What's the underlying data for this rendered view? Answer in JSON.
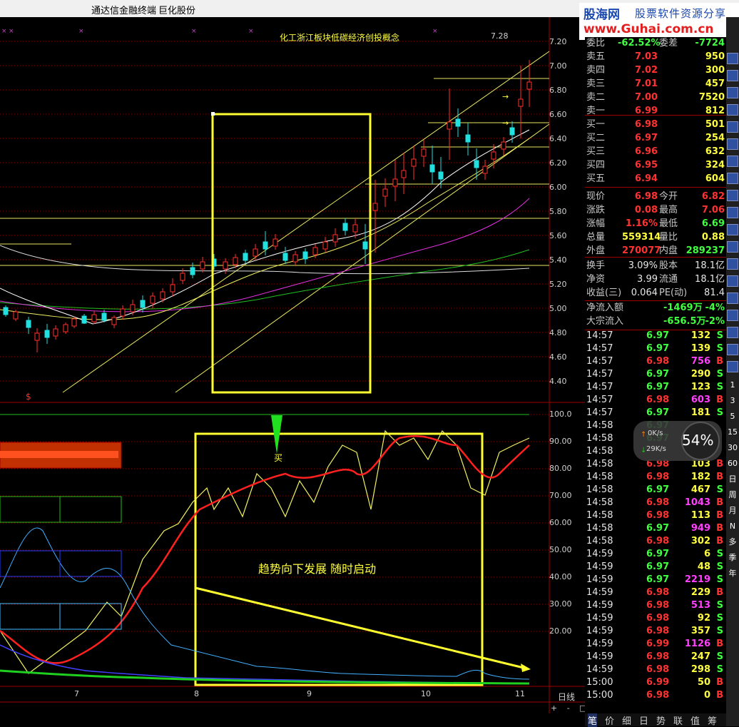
{
  "titlebar": {
    "app": "通达信金融终端",
    "stock": "巨化股份"
  },
  "watermark": {
    "brand": "股海网",
    "slogan": "股票软件资源分享",
    "url": "www.Guhai.com.cn"
  },
  "chart": {
    "title": "化工浙江板块低碳经济创投概念",
    "high_marker": "7.28",
    "annotation": "趋势向下发展 随时启动",
    "signal_label": "买",
    "period_label": "日线",
    "s_mark": "$",
    "price_axis": [
      "7.20",
      "7.00",
      "6.80",
      "6.60",
      "6.40",
      "6.20",
      "6.00",
      "5.80",
      "5.60",
      "5.40",
      "5.20",
      "5.00",
      "4.80",
      "4.60",
      "4.40"
    ],
    "osc_axis": [
      "100.0",
      "90.00",
      "80.00",
      "70.00",
      "60.00",
      "50.00",
      "40.00",
      "30.00",
      "20.00"
    ],
    "x_labels": [
      "7",
      "8",
      "9",
      "10",
      "11"
    ],
    "zoom": [
      "+",
      "-",
      "□"
    ]
  },
  "quote": {
    "weibi": {
      "label": "委比",
      "value": "-62.52%",
      "label2": "委差",
      "value2": "-7724"
    },
    "asks": [
      {
        "label": "卖五",
        "price": "7.03",
        "vol": "950"
      },
      {
        "label": "卖四",
        "price": "7.02",
        "vol": "300"
      },
      {
        "label": "卖三",
        "price": "7.01",
        "vol": "457"
      },
      {
        "label": "卖二",
        "price": "7.00",
        "vol": "7520"
      },
      {
        "label": "卖一",
        "price": "6.99",
        "vol": "812"
      }
    ],
    "bids": [
      {
        "label": "买一",
        "price": "6.98",
        "vol": "501"
      },
      {
        "label": "买二",
        "price": "6.97",
        "vol": "254"
      },
      {
        "label": "买三",
        "price": "6.96",
        "vol": "632"
      },
      {
        "label": "买四",
        "price": "6.95",
        "vol": "324"
      },
      {
        "label": "买五",
        "price": "6.94",
        "vol": "604"
      }
    ],
    "stats": [
      {
        "l1": "现价",
        "v1": "6.98",
        "l2": "今开",
        "v2": "6.82"
      },
      {
        "l1": "涨跌",
        "v1": "0.08",
        "l2": "最高",
        "v2": "7.06"
      },
      {
        "l1": "涨幅",
        "v1": "1.16%",
        "l2": "最低",
        "v2": "6.69"
      },
      {
        "l1": "总量",
        "v1": "559314",
        "l2": "量比",
        "v2": "0.88"
      },
      {
        "l1": "外盘",
        "v1": "270077",
        "l2": "内盘",
        "v2": "289237"
      }
    ],
    "fund": [
      {
        "l1": "换手",
        "v1": "3.09%",
        "l2": "股本",
        "v2": "18.1亿"
      },
      {
        "l1": "净资",
        "v1": "3.99",
        "l2": "流通",
        "v2": "18.1亿"
      },
      {
        "l1": "收益(三)",
        "v1": "0.064",
        "l2": "PE(动)",
        "v2": "81.4"
      }
    ],
    "flow": [
      {
        "label": "净流入额",
        "value": "-1469万",
        "pct": "-4%"
      },
      {
        "label": "大宗流入",
        "value": "-656.5万",
        "pct": "-2%"
      }
    ]
  },
  "ticks": [
    {
      "t": "14:57",
      "p": "6.97",
      "v": "132",
      "s": "S"
    },
    {
      "t": "14:57",
      "p": "6.97",
      "v": "139",
      "s": "S"
    },
    {
      "t": "14:57",
      "p": "6.98",
      "v": "756",
      "s": "B"
    },
    {
      "t": "14:57",
      "p": "6.97",
      "v": "290",
      "s": "S"
    },
    {
      "t": "14:57",
      "p": "6.97",
      "v": "123",
      "s": "S"
    },
    {
      "t": "14:57",
      "p": "6.98",
      "v": "603",
      "s": "B"
    },
    {
      "t": "14:57",
      "p": "6.97",
      "v": "181",
      "s": "S"
    },
    {
      "t": "14:58",
      "p": "6.97",
      "v": "",
      "s": ""
    },
    {
      "t": "14:58",
      "p": "6.97",
      "v": "",
      "s": ""
    },
    {
      "t": "14:58",
      "p": "",
      "v": "",
      "s": ""
    },
    {
      "t": "14:58",
      "p": "6.98",
      "v": "103",
      "s": "B"
    },
    {
      "t": "14:58",
      "p": "6.98",
      "v": "182",
      "s": "B"
    },
    {
      "t": "14:58",
      "p": "6.97",
      "v": "467",
      "s": "S"
    },
    {
      "t": "14:58",
      "p": "6.98",
      "v": "1043",
      "s": "B"
    },
    {
      "t": "14:58",
      "p": "6.98",
      "v": "113",
      "s": "B"
    },
    {
      "t": "14:58",
      "p": "6.97",
      "v": "949",
      "s": "B"
    },
    {
      "t": "14:58",
      "p": "6.98",
      "v": "302",
      "s": "B"
    },
    {
      "t": "14:59",
      "p": "6.97",
      "v": "6",
      "s": "S"
    },
    {
      "t": "14:59",
      "p": "6.97",
      "v": "48",
      "s": "S"
    },
    {
      "t": "14:59",
      "p": "6.97",
      "v": "2219",
      "s": "S"
    },
    {
      "t": "14:59",
      "p": "6.98",
      "v": "229",
      "s": "B"
    },
    {
      "t": "14:59",
      "p": "6.98",
      "v": "513",
      "s": "S"
    },
    {
      "t": "14:59",
      "p": "6.98",
      "v": "92",
      "s": "S"
    },
    {
      "t": "14:59",
      "p": "6.98",
      "v": "357",
      "s": "S"
    },
    {
      "t": "14:59",
      "p": "6.99",
      "v": "1126",
      "s": "B"
    },
    {
      "t": "14:59",
      "p": "6.98",
      "v": "247",
      "s": "S"
    },
    {
      "t": "14:59",
      "p": "6.98",
      "v": "298",
      "s": "S"
    },
    {
      "t": "15:00",
      "p": "6.99",
      "v": "50",
      "s": "B"
    },
    {
      "t": "15:00",
      "p": "6.98",
      "v": "0",
      "s": "B"
    }
  ],
  "speed": {
    "up": "0K/s",
    "down": "29K/s",
    "pct": "54%"
  },
  "bottom_tabs": [
    "笔",
    "价",
    "细",
    "日",
    "势",
    "联",
    "值",
    "筹"
  ],
  "side_toolbar": [
    "1",
    "3",
    "5",
    "15",
    "30",
    "60",
    "日",
    "周",
    "月",
    "N",
    "多",
    "季",
    "年"
  ]
}
